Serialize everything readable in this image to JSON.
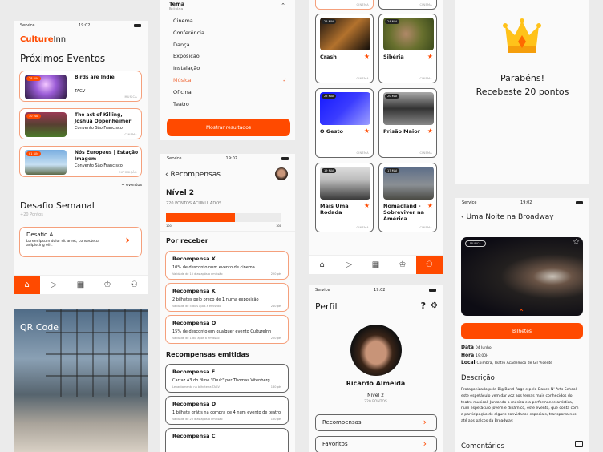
{
  "status": {
    "carrier": "Service",
    "time": "19:02"
  },
  "home": {
    "logo_a": "Culture",
    "logo_b": "Inn",
    "title": "Próximos Eventos",
    "events": [
      {
        "date": "28 MAI",
        "title": "Birds are Indie",
        "place": "TAGV",
        "cat": "MÚSICA"
      },
      {
        "date": "30 MAI",
        "title": "The act of Killing, Joshua Oppenheimer",
        "place": "Convento São Francisco",
        "cat": "CINEMA"
      },
      {
        "date": "01 JUN",
        "title": "Nós Europeus | Estação Imagem",
        "place": "Convento São Francisco",
        "cat": "EXPOSIÇÃO"
      }
    ],
    "more": "+ eventos",
    "challenge_title": "Desafio Semanal",
    "challenge_points": "+20 Pontos",
    "challenge": {
      "title": "Desafio A",
      "desc": "Lorem ipsum dolor sit amet, consectetur adipiscing elit."
    }
  },
  "qr": {
    "title": "QR Code"
  },
  "filter": {
    "label": "Tema",
    "selected": "Música",
    "options": [
      "Cinema",
      "Conferência",
      "Dança",
      "Exposição",
      "Instalação",
      "Música",
      "Oficina",
      "Teatro"
    ],
    "button": "Mostrar resultados"
  },
  "rewards": {
    "title": "Recompensas",
    "level": "Nível 2",
    "points": "220 PONTOS ACUMULADOS",
    "progress_min": "100",
    "progress_max": "300",
    "progress_pct": 60,
    "pending_title": "Por receber",
    "pending": [
      {
        "t": "Recompensa X",
        "d": "10% de desconto num evento de cinema",
        "v": "Validade de 15 dias após a emissão",
        "p": "220 pts"
      },
      {
        "t": "Recompensa K",
        "d": "2 bilhetes pelo preço de 1 numa exposição",
        "v": "Validade de 5 dias após a emissão",
        "p": "210 pts"
      },
      {
        "t": "Recompensa Q",
        "d": "15% de desconto em qualquer evento CultureInn",
        "v": "Validade de 1 dia após a emissão",
        "p": "200 pts"
      }
    ],
    "issued_title": "Recompensas emitidas",
    "issued": [
      {
        "t": "Recompensa E",
        "d": "Cartaz A3 do filme \"Druk\" por Thomas Vitenberg",
        "v": "Levantamento na bilheteira TAGV",
        "p": "180 pts"
      },
      {
        "t": "Recompensa D",
        "d": "1 bilhete grátis na compra de 4 num evento de teatro",
        "v": "Validade de 20 dias após a emissão",
        "p": "150 pts"
      },
      {
        "t": "Recompensa C",
        "d": "",
        "v": "",
        "p": ""
      }
    ]
  },
  "favorites": {
    "top_cat": "CINEMA",
    "items": [
      {
        "date": "25 MAI",
        "title": "Crash",
        "cat": "CINEMA"
      },
      {
        "date": "24 MAI",
        "title": "Sibéria",
        "cat": "CINEMA"
      },
      {
        "date": "25 MAI",
        "title": "O Gesto",
        "cat": "CINEMA"
      },
      {
        "date": "20 MAI",
        "title": "Prisão Maior",
        "cat": "CINEMA"
      },
      {
        "date": "19 MAI",
        "title": "Mais Uma Rodada",
        "cat": "CINEMA"
      },
      {
        "date": "17 MAI",
        "title": "Nomadland - Sobreviver na América",
        "cat": "CINEMA"
      }
    ]
  },
  "profile": {
    "title": "Perfil",
    "name": "Ricardo Almeida",
    "level": "Nível 2",
    "points": "220 PONTOS",
    "links": [
      "Recompensas",
      "Favoritos"
    ]
  },
  "congrats": {
    "line1": "Parabéns!",
    "line2": "Recebeste 20 pontos"
  },
  "event": {
    "title": "Uma Noite na Broadway",
    "tag": "MÚSICA",
    "button": "Bilhetes",
    "date_l": "Data",
    "date": "04 Junho",
    "hour_l": "Hora",
    "hour": "19:00H",
    "place_l": "Local",
    "place": "Coimbra, Teatro Académico de Gil Vicente",
    "desc_title": "Descrição",
    "desc": "Protagonizado pela Big Band Rags e pela Dance N' Arts School, este espetáculo vem dar voz aos temas mais conhecidos do teatro musical. Juntando a música e a performance artística, num espetáculo jovem e dinâmico, este evento, que conta com a participação de alguns convidados especiais, transporta-nos até aos palcos da Broadway.",
    "comments": "Comentários"
  }
}
